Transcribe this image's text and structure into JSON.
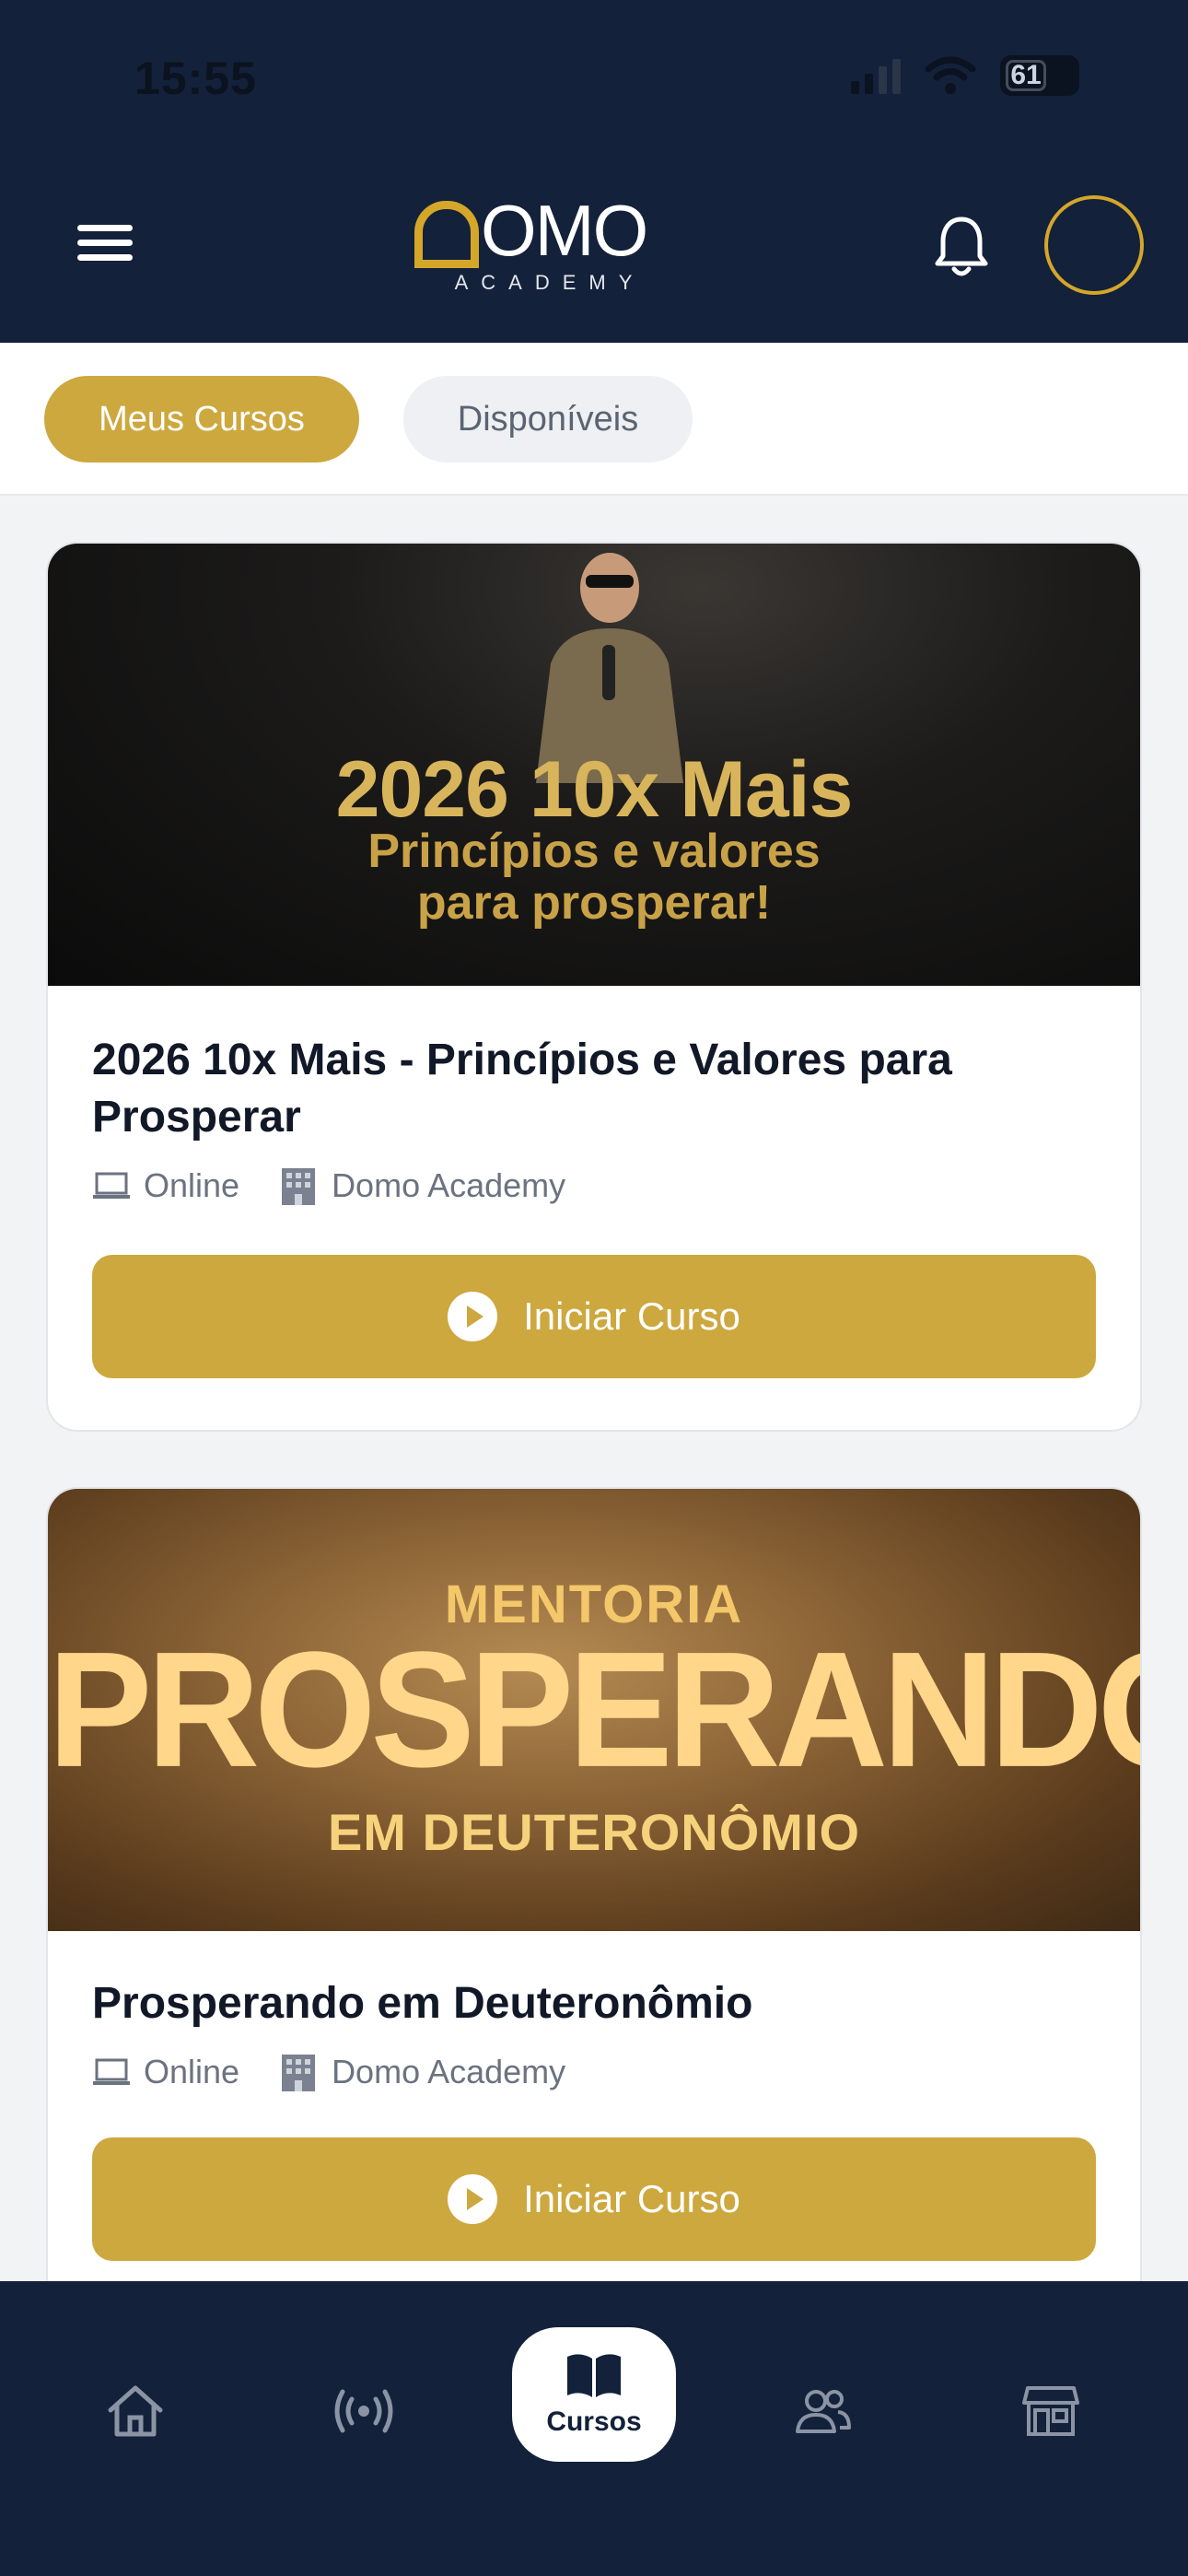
{
  "status_bar": {
    "time": "15:55",
    "battery": "61"
  },
  "header": {
    "logo_text": "OMO",
    "logo_sub": "ACADEMY"
  },
  "tabs": [
    {
      "label": "Meus Cursos",
      "active": true
    },
    {
      "label": "Disponíveis",
      "active": false
    }
  ],
  "courses": [
    {
      "banner": {
        "title": "2026 10x Mais",
        "subtitle_1": "Princípios e valores",
        "subtitle_2": "para prosperar!"
      },
      "title": "2026 10x Mais - Princípios e Valores para Prosperar",
      "mode": "Online",
      "provider": "Domo Academy",
      "cta": "Iniciar Curso"
    },
    {
      "banner": {
        "top": "MENTORIA",
        "main": "PROSPERANDO",
        "bottom": "EM DEUTERONÔMIO"
      },
      "title": "Prosperando em Deuteronômio",
      "mode": "Online",
      "provider": "Domo Academy",
      "cta": "Iniciar Curso"
    }
  ],
  "bottom_nav": {
    "items": [
      {
        "icon": "home-icon"
      },
      {
        "icon": "live-broadcast-icon"
      },
      {
        "icon": "book-icon",
        "label": "Cursos",
        "active": true
      },
      {
        "icon": "community-icon"
      },
      {
        "icon": "store-icon"
      }
    ]
  },
  "colors": {
    "navy": "#13213a",
    "gold": "#cda83f"
  }
}
